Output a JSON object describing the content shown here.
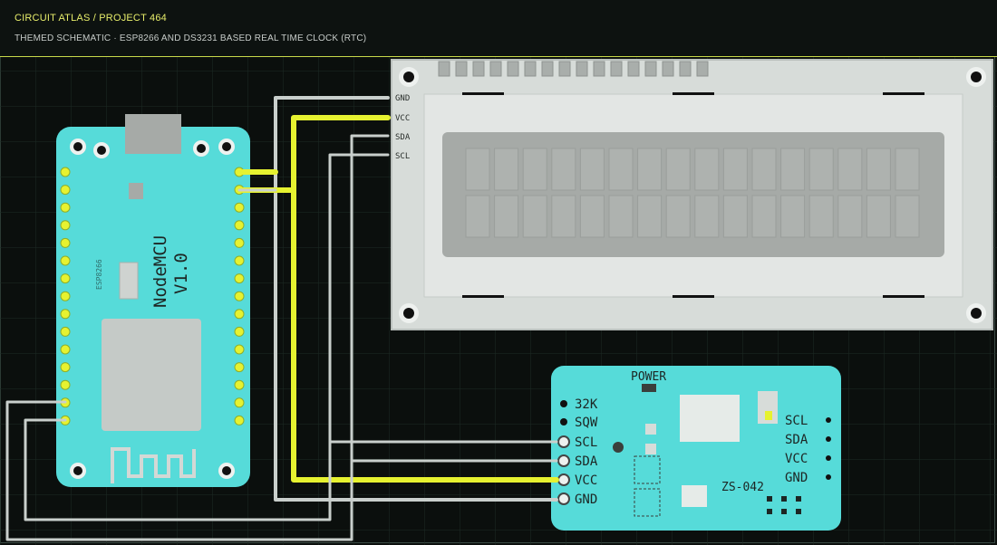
{
  "header": {
    "title": "CIRCUIT ATLAS / PROJECT 464",
    "subtitle": "THEMED SCHEMATIC · ESP8266 AND DS3231 BASED REAL TIME CLOCK (RTC)"
  },
  "nodemcu": {
    "name": "NodeMCU",
    "version": "V1.0",
    "silk_small": "ESP8266"
  },
  "lcd": {
    "pins": [
      "GND",
      "VCC",
      "SDA",
      "SCL"
    ]
  },
  "rtc": {
    "power_label": "POWER",
    "left_pins": [
      "32K",
      "SQW",
      "SCL",
      "SDA",
      "VCC",
      "GND"
    ],
    "right_pins": [
      "SCL",
      "SDA",
      "VCC",
      "GND"
    ],
    "chip_label": "ZS-042"
  },
  "colors": {
    "background": "#0b0f0d",
    "grid": "#1c2a24",
    "board": "#56dbd9",
    "wire_power": "#e6f230",
    "wire_signal": "#c9cfcc",
    "lcd_body": "#d7dcd9",
    "lcd_screen": "#a6aaa7",
    "header_accent": "#c8d94a"
  },
  "icons": [
    "wifi-antenna-icon",
    "usb-connector-icon",
    "battery-icon"
  ]
}
